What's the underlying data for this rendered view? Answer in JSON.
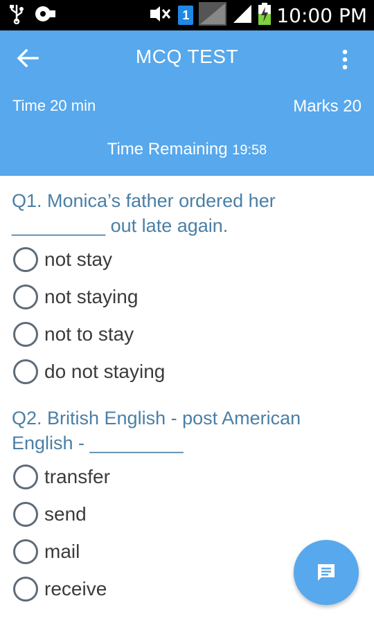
{
  "status_bar": {
    "icons": [
      "usb-icon",
      "voicemail-icon",
      "silent-icon",
      "sim-icon",
      "signal-icon",
      "signal-icon",
      "battery-charging-icon"
    ],
    "sim_label": "1",
    "time": "10:00 PM"
  },
  "app_bar": {
    "title": "MCQ TEST",
    "back_icon": "arrow-left-icon",
    "menu_icon": "more-vert-icon",
    "time_label": "Time 20 min",
    "marks_label": "Marks 20",
    "remaining_label": "Time Remaining",
    "remaining_value": "19:58",
    "color": "#57a8ec"
  },
  "questions": [
    {
      "text": "Q1. Monica’s father ordered her _________ out late again.",
      "options": [
        "not stay",
        "not staying",
        "not to stay",
        "do not staying"
      ]
    },
    {
      "text": "Q2. British English - post American English - _________",
      "options": [
        "transfer",
        "send",
        "mail",
        "receive"
      ]
    }
  ],
  "fab": {
    "icon": "chat-icon",
    "color": "#57a8ec"
  }
}
